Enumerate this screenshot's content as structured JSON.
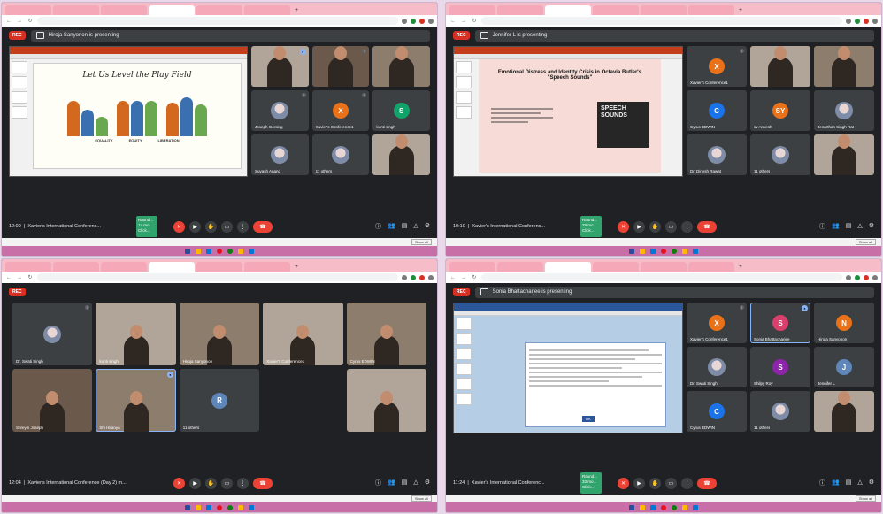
{
  "panels": [
    {
      "tabs": [
        "",
        "",
        "",
        "",
        "",
        "",
        ""
      ],
      "url": "",
      "presenter_banner": "Hiroja Sanyonon is presenting",
      "slide_title": "Let Us Level the Play Field",
      "slide_labels": [
        "EQUALITY",
        "EQUITY",
        "LIBERATION"
      ],
      "participants": [
        {
          "name": "",
          "kind": "video"
        },
        {
          "name": "",
          "kind": "video"
        },
        {
          "name": "",
          "kind": "video"
        },
        {
          "name": "Joseph Gorsing",
          "kind": "photo"
        },
        {
          "name": "Xavier's Conference1",
          "kind": "letter",
          "letter": "X",
          "color": "#e8711a"
        },
        {
          "name": "kunti singh",
          "kind": "letter",
          "letter": "S",
          "color": "#12a36a"
        },
        {
          "name": "Suyash Anand",
          "kind": "photo"
        },
        {
          "name": "11 others",
          "kind": "group"
        },
        {
          "name": "",
          "kind": "video"
        }
      ],
      "meeting_time": "12:00",
      "meeting_name": "Xavier's International Conferenc...",
      "toast_text": "Raund... 14 mo... Click...",
      "downloads": [
        "",
        "",
        "",
        ""
      ],
      "show_all": "Show all"
    },
    {
      "presenter_banner": "Jennifer L is presenting",
      "slide_title": "Emotional Distress and Identity Crisis in Octavia Butler's \"Speech Sounds\"",
      "cover_text": "SPEECH SOUNDS",
      "participants": [
        {
          "name": "Xavier's Conference1",
          "kind": "letter",
          "letter": "X",
          "color": "#e8711a"
        },
        {
          "name": "",
          "kind": "video"
        },
        {
          "name": "",
          "kind": "video"
        },
        {
          "name": "Cyrus EDWIN",
          "kind": "letter",
          "letter": "C",
          "color": "#1a73e8"
        },
        {
          "name": "sv Anvesh",
          "kind": "letter",
          "letter": "SY",
          "color": "#e8711a"
        },
        {
          "name": "Jenarthan Singh Rat",
          "kind": "photo"
        },
        {
          "name": "Dr. Dinesh Rawat",
          "kind": "photo"
        },
        {
          "name": "11 others",
          "kind": "group"
        },
        {
          "name": "",
          "kind": "video"
        }
      ],
      "meeting_time": "10:10",
      "meeting_name": "Xavier's International Conferenc...",
      "toast_text": "Raund... 28 mo... Click...",
      "show_all": "Show all"
    },
    {
      "participants": [
        {
          "name": "Dr. Swati Singh",
          "kind": "photo"
        },
        {
          "name": "kunti singh",
          "kind": "video"
        },
        {
          "name": "Hiroja Sanyonon",
          "kind": "video"
        },
        {
          "name": "Xavier's Conference1",
          "kind": "video"
        },
        {
          "name": "Cyrus EDWIN",
          "kind": "video"
        },
        {
          "name": "Shreyin Joseph",
          "kind": "video"
        },
        {
          "name": "Shi Hiranya",
          "kind": "video"
        },
        {
          "name": "11 others",
          "kind": "group"
        },
        {
          "name": "",
          "kind": "video"
        }
      ],
      "meeting_time": "12:04",
      "meeting_name": "Xavier's International Conference (Day 2) m...",
      "show_all": "Show all"
    },
    {
      "presenter_banner": "Sonia Bhattacharjee is presenting",
      "doc_heading": "",
      "dialog_button": "OK",
      "participants": [
        {
          "name": "Xavier's Conference1",
          "kind": "letter",
          "letter": "X",
          "color": "#e8711a"
        },
        {
          "name": "Sonia Bhattacharjee",
          "kind": "letter",
          "letter": "S",
          "color": "#d93f6a",
          "outlined": true
        },
        {
          "name": "Hiroja Sanyonon",
          "kind": "letter",
          "letter": "N",
          "color": "#e8711a"
        },
        {
          "name": "Dr. Swati Singh",
          "kind": "photo"
        },
        {
          "name": "Shilpy Roy",
          "kind": "letter",
          "letter": "S",
          "color": "#8e24aa"
        },
        {
          "name": "Jennifer L",
          "kind": "letter",
          "letter": "J",
          "color": "#5f86b8"
        },
        {
          "name": "Cyrus EDWIN",
          "kind": "letter",
          "letter": "C",
          "color": "#1a73e8"
        },
        {
          "name": "11 others",
          "kind": "group"
        },
        {
          "name": "",
          "kind": "video"
        }
      ],
      "meeting_time": "11:24",
      "meeting_name": "Xavier's International Conferenc...",
      "toast_text": "Raund... 33 mo... Click...",
      "show_all": "Show all"
    }
  ],
  "colors": {
    "meet_bg": "#202124",
    "tile_bg": "#3c4043",
    "tab_bar": "#f6bcc8",
    "taskbar": "#c86fa7",
    "hangup": "#ea4335",
    "record": "#d93025"
  }
}
